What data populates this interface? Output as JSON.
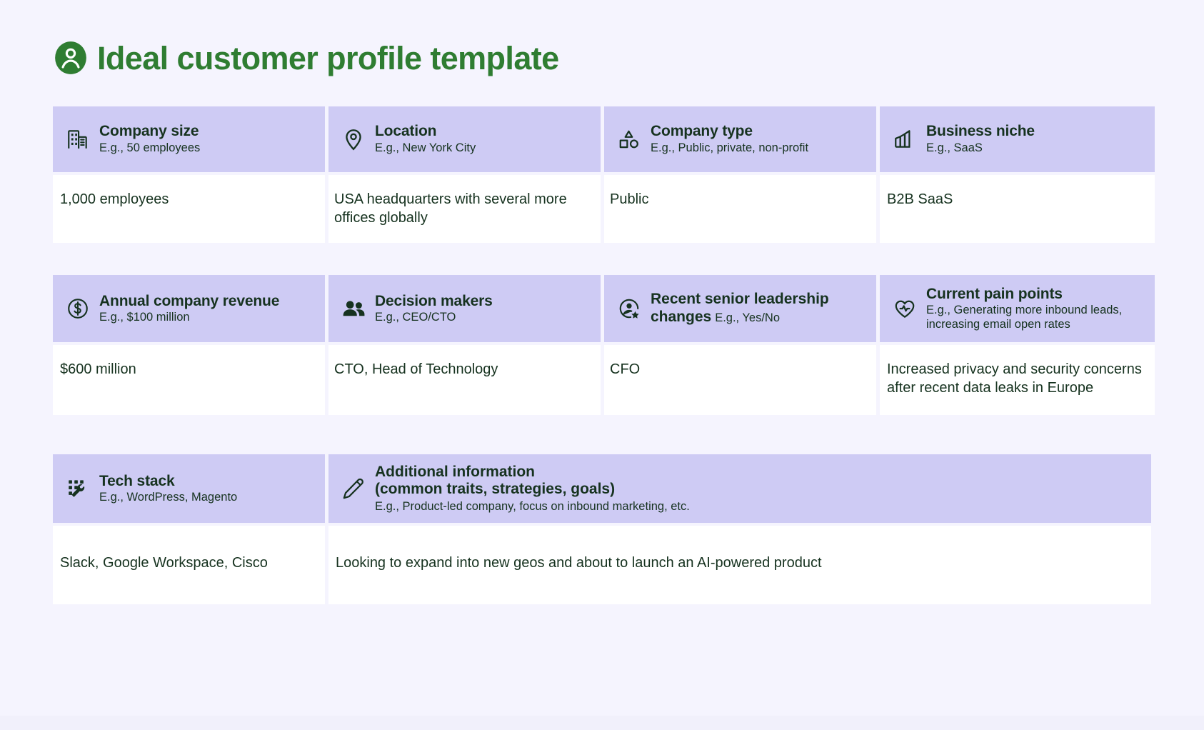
{
  "page": {
    "title": "Ideal customer profile template",
    "title_icon": "user-circle-icon",
    "accent_color": "#2f7d32",
    "background_color": "#f5f4fe",
    "header_cell_color": "#cecbf4",
    "answer_cell_color": "#ffffff",
    "text_color": "#16321f"
  },
  "rows": [
    {
      "id": "row-1",
      "cells": [
        {
          "icon": "office-building-icon",
          "title": "Company size",
          "subtitle": "E.g., 50 employees",
          "answer": "1,000 employees"
        },
        {
          "icon": "map-pin-icon",
          "title": "Location",
          "subtitle": "E.g., New York City",
          "answer": "USA headquarters with several more offices globally"
        },
        {
          "icon": "shapes-icon",
          "title": "Company type",
          "subtitle": "E.g., Public, private, non-profit",
          "answer": "Public"
        },
        {
          "icon": "bar-chart-factory-icon",
          "title": "Business niche",
          "subtitle": "E.g., SaaS",
          "answer": "B2B SaaS"
        }
      ]
    },
    {
      "id": "row-2",
      "cells": [
        {
          "icon": "dollar-circle-icon",
          "title": "Annual company revenue",
          "subtitle": "E.g., $100 million",
          "answer": "$600 million"
        },
        {
          "icon": "people-icon",
          "title": "Decision makers",
          "subtitle": "E.g., CEO/CTO",
          "answer": "CTO, Head of Technology"
        },
        {
          "icon": "user-star-icon",
          "title_line1": "Recent senior leadership",
          "title_line2": "changes",
          "subtitle_inline": "E.g., Yes/No",
          "answer": "CFO"
        },
        {
          "icon": "heart-pulse-icon",
          "title": "Current pain points",
          "subtitle": "E.g., Generating more inbound leads, increasing email open rates",
          "answer": "Increased privacy and security concerns after recent data leaks in Europe"
        }
      ]
    },
    {
      "id": "row-3",
      "cells": [
        {
          "icon": "tech-stack-wrench-icon",
          "title": "Tech stack",
          "subtitle": "E.g., WordPress, Magento",
          "answer": "Slack, Google Workspace, Cisco"
        },
        {
          "icon": "pencil-icon",
          "title_line1": "Additional information",
          "title_line2": "(common traits, strategies, goals)",
          "subtitle": "E.g., Product-led company, focus on inbound marketing, etc.",
          "answer": "Looking to expand into new geos and about to launch an AI-powered product"
        }
      ]
    }
  ]
}
